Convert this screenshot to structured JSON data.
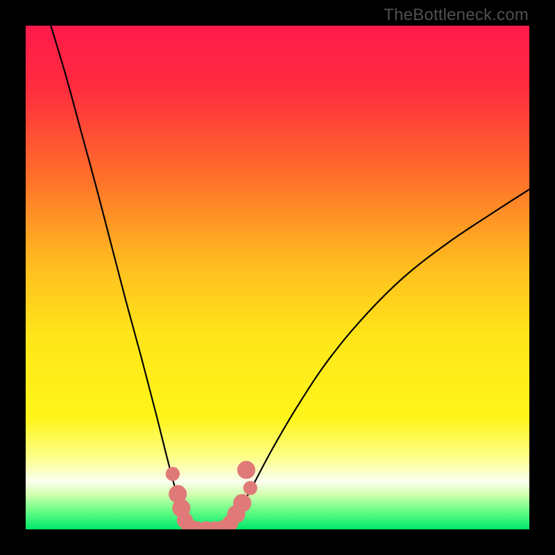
{
  "watermark": "TheBottleneck.com",
  "chart_data": {
    "type": "line",
    "title": "",
    "xlabel": "",
    "ylabel": "",
    "xlim": [
      0,
      100
    ],
    "ylim": [
      0,
      100
    ],
    "gradient_stops": [
      {
        "offset": 0.0,
        "color": "#ff1a4b"
      },
      {
        "offset": 0.12,
        "color": "#ff2b3f"
      },
      {
        "offset": 0.3,
        "color": "#ff6f2a"
      },
      {
        "offset": 0.48,
        "color": "#ffbf1f"
      },
      {
        "offset": 0.62,
        "color": "#ffe61a"
      },
      {
        "offset": 0.78,
        "color": "#fff51a"
      },
      {
        "offset": 0.86,
        "color": "#fcff8f"
      },
      {
        "offset": 0.905,
        "color": "#fafff0"
      },
      {
        "offset": 0.93,
        "color": "#d4ffb0"
      },
      {
        "offset": 0.96,
        "color": "#72ff89"
      },
      {
        "offset": 1.0,
        "color": "#00e86a"
      }
    ],
    "series": [
      {
        "name": "bottleneck-curve-left",
        "x": [
          5,
          8,
          11,
          14,
          17,
          20,
          23,
          26,
          28,
          30,
          31.5,
          33
        ],
        "y": [
          100,
          90,
          79,
          68,
          56.5,
          45,
          34,
          22.5,
          14.5,
          7,
          2.5,
          0
        ]
      },
      {
        "name": "bottleneck-curve-right",
        "x": [
          40,
          42,
          45,
          49,
          54,
          60,
          67,
          75,
          84,
          93,
          100
        ],
        "y": [
          0,
          3,
          8.5,
          16,
          24.5,
          33.5,
          42,
          50,
          57,
          63,
          67.5
        ]
      }
    ],
    "markers": {
      "name": "highlight-points",
      "color": "#e07a78",
      "points": [
        {
          "x": 29.2,
          "y": 11.0,
          "r": 1.4
        },
        {
          "x": 30.2,
          "y": 7.0,
          "r": 1.8
        },
        {
          "x": 30.9,
          "y": 4.2,
          "r": 1.8
        },
        {
          "x": 31.6,
          "y": 1.8,
          "r": 1.6
        },
        {
          "x": 32.5,
          "y": 0.5,
          "r": 1.6
        },
        {
          "x": 34.0,
          "y": 0.0,
          "r": 1.6
        },
        {
          "x": 35.8,
          "y": 0.0,
          "r": 1.6
        },
        {
          "x": 37.5,
          "y": 0.0,
          "r": 1.6
        },
        {
          "x": 39.2,
          "y": 0.2,
          "r": 1.6
        },
        {
          "x": 40.6,
          "y": 1.2,
          "r": 1.6
        },
        {
          "x": 41.8,
          "y": 3.0,
          "r": 1.8
        },
        {
          "x": 43.0,
          "y": 5.2,
          "r": 1.8
        },
        {
          "x": 44.6,
          "y": 8.2,
          "r": 1.4
        },
        {
          "x": 43.8,
          "y": 11.8,
          "r": 1.8
        }
      ]
    }
  }
}
